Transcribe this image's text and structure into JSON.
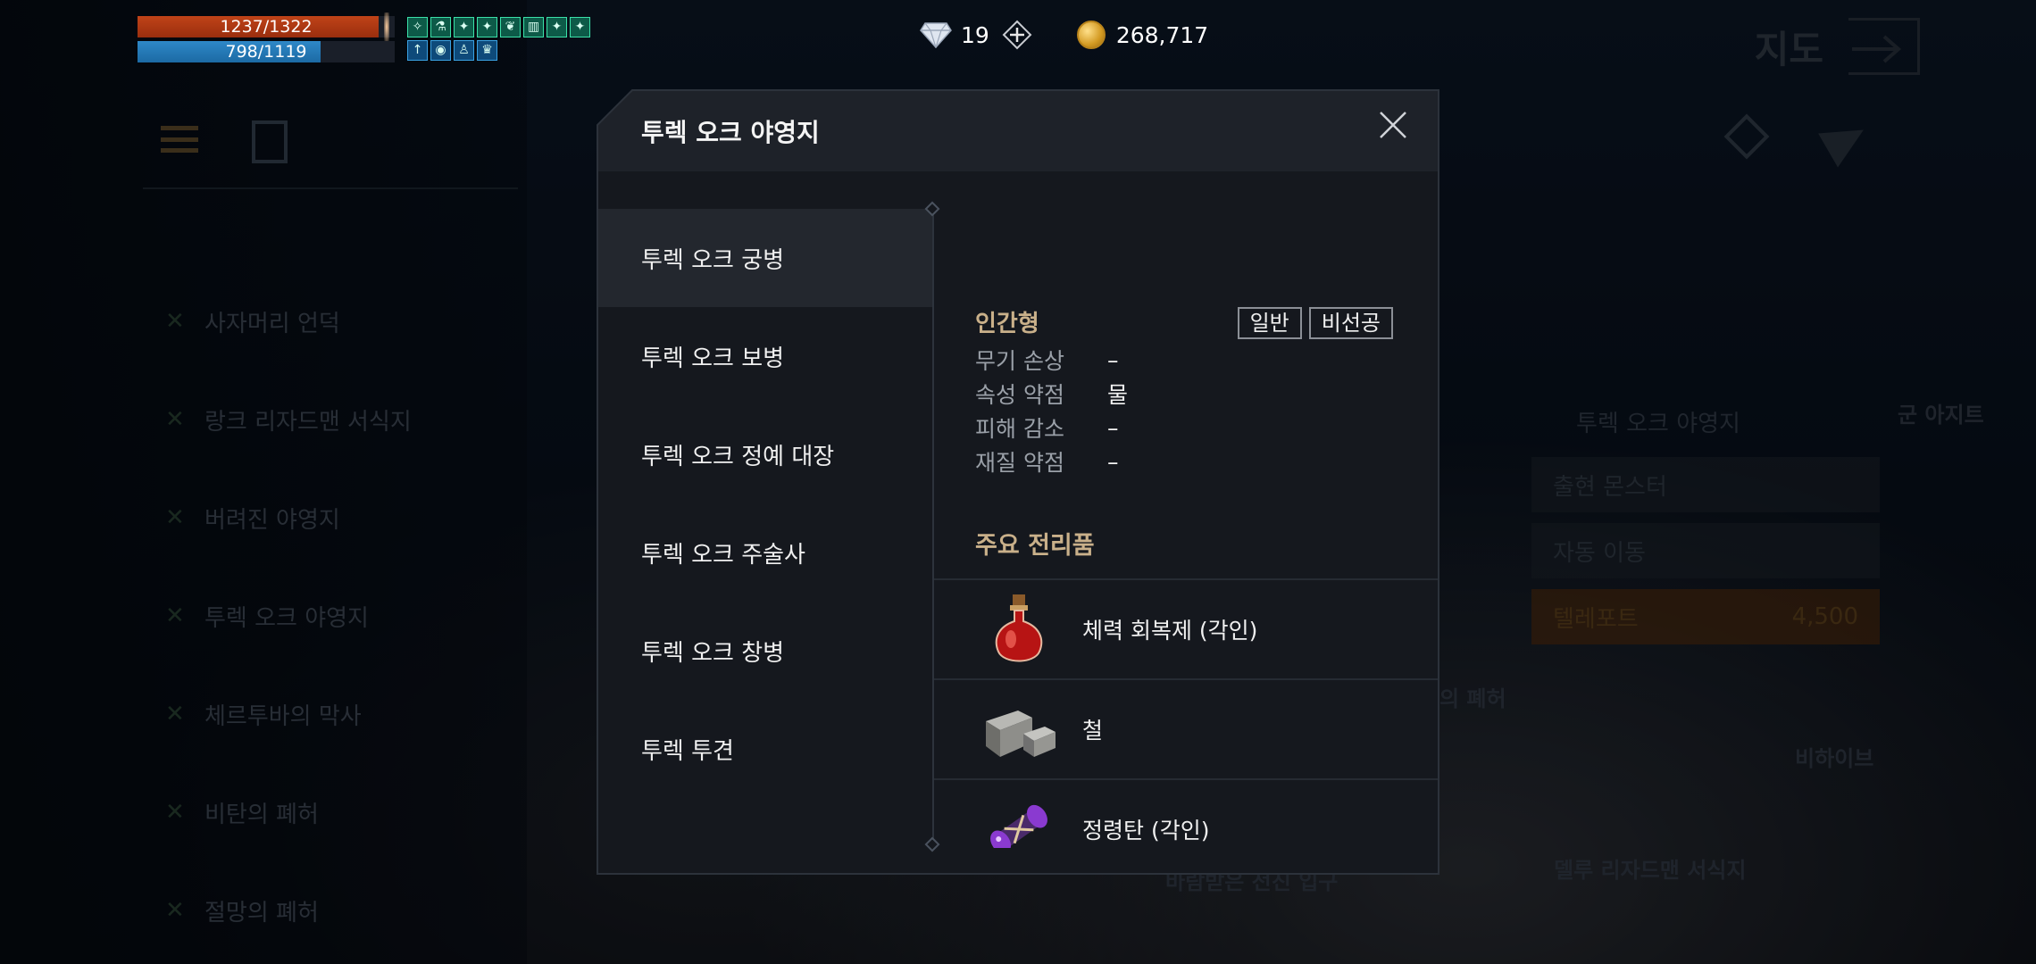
{
  "hud": {
    "hp": {
      "text": "1237/1322",
      "fraction": 0.936
    },
    "mp": {
      "text": "798/1119",
      "fraction": 0.713
    },
    "buffs_row1": [
      "swan-icon",
      "flask-icon",
      "beast-icon",
      "beast-icon",
      "leaf-icon",
      "totem-icon",
      "beast-icon",
      "beast-icon"
    ],
    "buffs_row2": [
      "arrow-up-icon",
      "swirl-icon",
      "person-icon",
      "crown-icon"
    ]
  },
  "currency": {
    "gems": "19",
    "gold": "268,717"
  },
  "background": {
    "map_title": "지도",
    "locations": [
      "사자머리 언덕",
      "랑크 리자드맨 서식지",
      "버려진 야영지",
      "투렉 오크 야영지",
      "체르투바의 막사",
      "비탄의 폐허",
      "절망의 폐허"
    ],
    "right_panel": {
      "title": "투렉 오크 야영지",
      "buttons": [
        "출현 몬스터",
        "자동 이동",
        "텔레포트"
      ],
      "teleport_cost": "4,500"
    },
    "labels": {
      "hideout": "군 아지트",
      "ruins": "의 폐허",
      "bihaive": "비하이브",
      "delu": "델루 리자드맨 서식지",
      "bottom1": "바람받은 전진 입구"
    }
  },
  "modal": {
    "title": "투렉 오크 야영지",
    "monsters": [
      "투렉 오크 궁병",
      "투렉 오크 보병",
      "투렉 오크 정예 대장",
      "투렉 오크 주술사",
      "투렉 오크 창병",
      "투렉 투견"
    ],
    "selected_index": 0,
    "detail": {
      "type": "인간형",
      "tags": [
        "일반",
        "비선공"
      ],
      "stats": [
        {
          "label": "무기 손상",
          "value": "–"
        },
        {
          "label": "속성 약점",
          "value": "물"
        },
        {
          "label": "피해 감소",
          "value": "–"
        },
        {
          "label": "재질 약점",
          "value": "–"
        }
      ],
      "loot_title": "주요 전리품",
      "loot": [
        {
          "name": "체력 회복제 (각인)",
          "icon": "red-potion-icon"
        },
        {
          "name": "철",
          "icon": "iron-ingot-icon"
        },
        {
          "name": "정령탄 (각인)",
          "icon": "spirit-shot-icon"
        },
        {
          "name": "",
          "icon": "blue-crystal-icon"
        }
      ]
    }
  },
  "colors": {
    "accent_gold": "#c9b08a",
    "hp": "#c04318",
    "mp": "#2e88c8",
    "buff": "#3be0a8"
  }
}
